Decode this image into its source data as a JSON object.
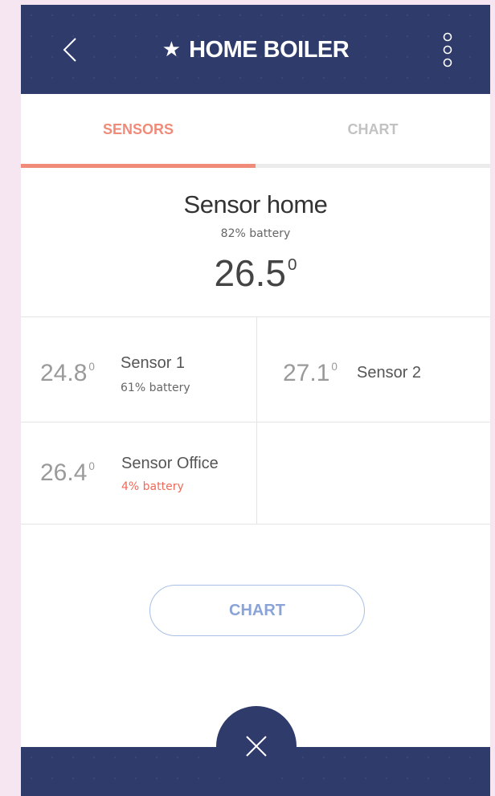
{
  "header": {
    "title": "HOME BOILER",
    "title_icon": "star-icon",
    "back_icon": "chevron-left-icon",
    "more_icon": "more-vertical-icon",
    "background_color": "#2f3b6b"
  },
  "tabs": [
    {
      "label": "SENSORS",
      "active": true
    },
    {
      "label": "CHART",
      "active": false
    }
  ],
  "colors": {
    "accent": "#f08b7a",
    "low_battery": "#f06b5a",
    "button_outline": "#a8c0e8"
  },
  "main_sensor": {
    "name": "Sensor home",
    "battery": "82% battery",
    "temp": "26.5",
    "unit": "0"
  },
  "sensors": [
    {
      "temp": "24.8",
      "unit": "0",
      "name": "Sensor 1",
      "battery": "61% battery"
    },
    {
      "temp": "27.1",
      "unit": "0",
      "name": "Sensor 2",
      "battery": ""
    },
    {
      "temp": "26.4",
      "unit": "0",
      "name": "Sensor Office",
      "battery": "4% battery",
      "battery_low": true
    }
  ],
  "chart_button": {
    "label": "CHART"
  },
  "fab": {
    "icon": "close-icon"
  }
}
